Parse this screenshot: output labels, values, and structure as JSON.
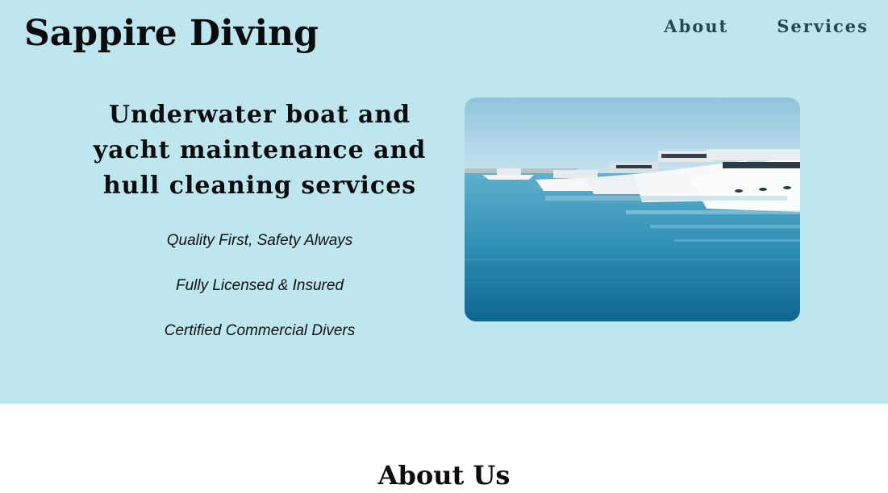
{
  "brand": {
    "name": "Sappire Diving"
  },
  "nav": {
    "items": [
      {
        "label": "About"
      },
      {
        "label": "Services"
      }
    ]
  },
  "hero": {
    "headline": "Underwater boat and yacht maintenance and hull cleaning services",
    "taglines": [
      "Quality First, Safety Always",
      "Fully Licensed & Insured",
      "Certified Commercial Divers"
    ],
    "image": {
      "subject": "yachts-in-marina"
    }
  },
  "about": {
    "title": "About Us"
  },
  "colors": {
    "hero_background": "#bde6ee",
    "nav_text": "#1f4a55",
    "heading_text": "#0c0c0c",
    "page_background": "#ffffff"
  }
}
